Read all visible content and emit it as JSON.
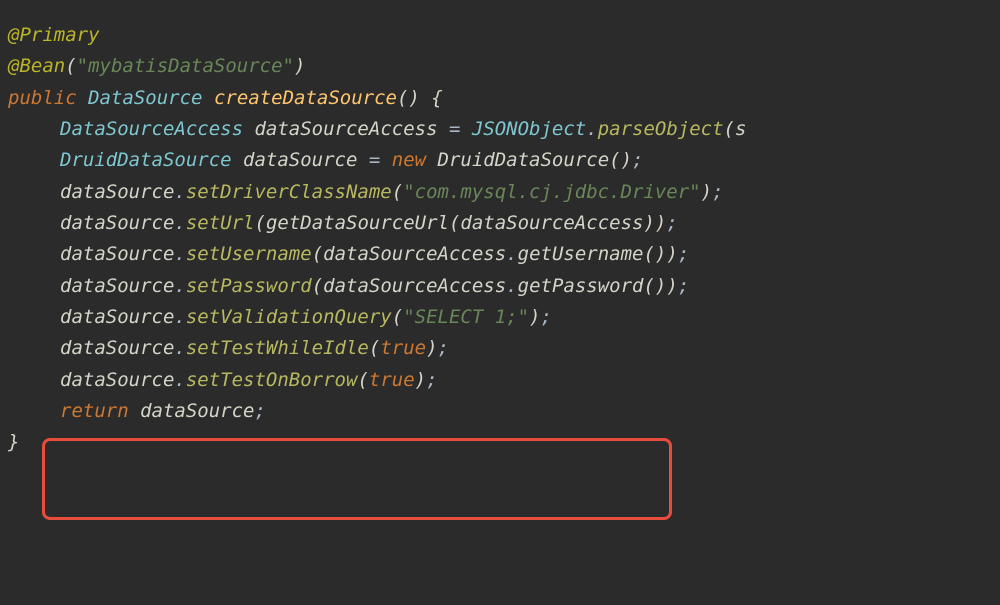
{
  "code": {
    "line1": {
      "annotation": "@Primary"
    },
    "line2": {
      "annotation": "@Bean",
      "open": "(",
      "string": "\"mybatisDataSource\"",
      "close": ")"
    },
    "line3": {
      "modifier": "public",
      "returnType": "DataSource",
      "methodName": "createDataSource",
      "parens": "()",
      "brace": " {"
    },
    "line4": {
      "type": "DataSourceAccess",
      "var": "dataSourceAccess",
      "eq": " = ",
      "clazz": "JSONObject",
      "dot": ".",
      "method": "parseObject",
      "open": "(",
      "tail": "s"
    },
    "line5": {
      "type": "DruidDataSource",
      "var": "dataSource",
      "eq": " = ",
      "new": "new",
      "clazz": "DruidDataSource",
      "parens": "()",
      "semi": ";"
    },
    "line6": {
      "var": "dataSource",
      "dot": ".",
      "method": "setDriverClassName",
      "open": "(",
      "string": "\"com.mysql.cj.jdbc.Driver\"",
      "close": ")",
      "semi": ";"
    },
    "line7": {
      "var": "dataSource",
      "dot": ".",
      "method": "setUrl",
      "open": "(",
      "inner": "getDataSourceUrl",
      "open2": "(",
      "arg": "dataSourceAccess",
      "close2": ")",
      "close": ")",
      "semi": ";"
    },
    "line8": {
      "var": "dataSource",
      "dot": ".",
      "method": "setUsername",
      "open": "(",
      "arg": "dataSourceAccess",
      "dot2": ".",
      "inner": "getUsername",
      "parens": "()",
      "close": ")",
      "semi": ";"
    },
    "line9": {
      "var": "dataSource",
      "dot": ".",
      "method": "setPassword",
      "open": "(",
      "arg": "dataSourceAccess",
      "dot2": ".",
      "inner": "getPassword",
      "parens": "()",
      "close": ")",
      "semi": ";"
    },
    "line10": {
      "var": "dataSource",
      "dot": ".",
      "method": "setValidationQuery",
      "open": "(",
      "string": "\"SELECT 1;\"",
      "close": ")",
      "semi": ";"
    },
    "line11": {
      "var": "dataSource",
      "dot": ".",
      "method": "setTestWhileIdle",
      "open": "(",
      "kw": "true",
      "close": ")",
      "semi": ";"
    },
    "line12": {
      "var": "dataSource",
      "dot": ".",
      "method": "setTestOnBorrow",
      "open": "(",
      "kw": "true",
      "close": ")",
      "semi": ";"
    },
    "line13": {
      "kw": "return",
      "var": "dataSource",
      "semi": ";"
    },
    "line14": {
      "brace": "}"
    }
  },
  "highlight": {
    "color": "#e74c3c"
  }
}
